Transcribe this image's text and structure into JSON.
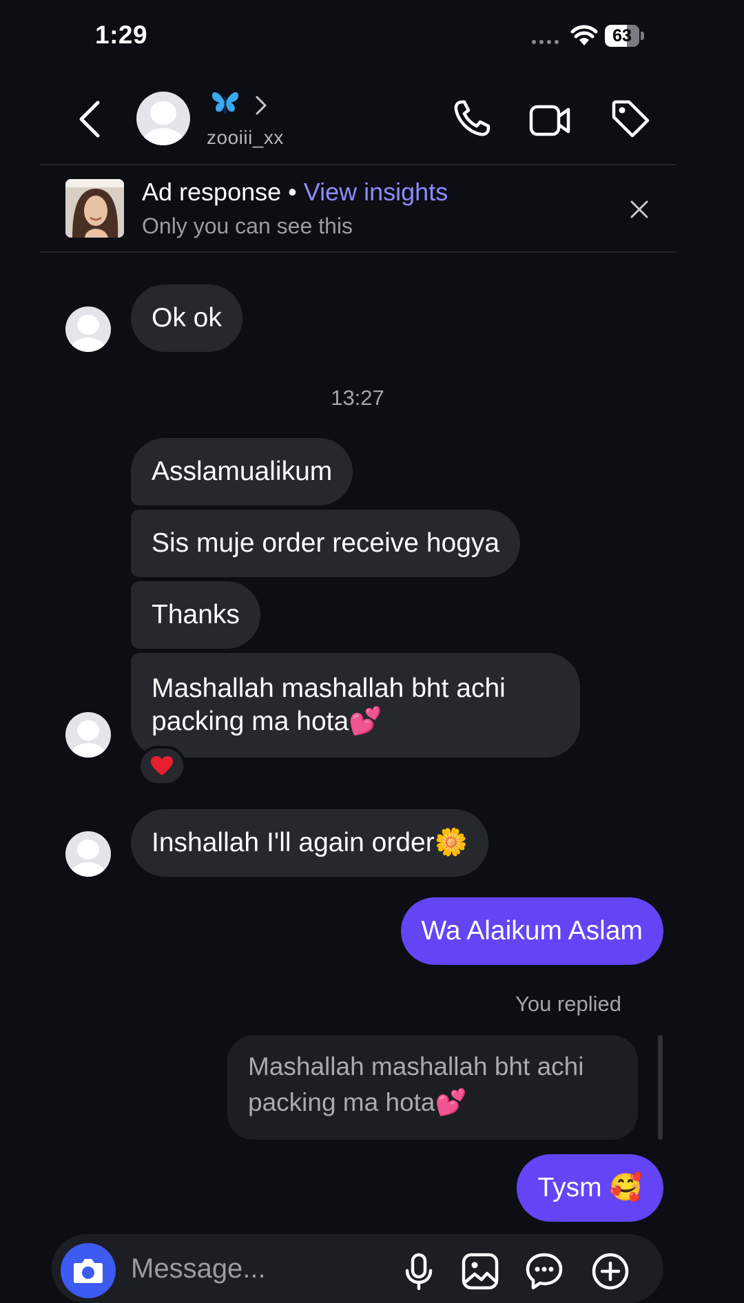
{
  "status_bar": {
    "time": "1:29",
    "battery": "63",
    "battery_level": 0.63
  },
  "header": {
    "name_emoji": "🦋",
    "username": "zooiii_xx"
  },
  "ad_banner": {
    "title": "Ad response",
    "separator": "•",
    "link": "View insights",
    "subtitle": "Only you can see this"
  },
  "messages": {
    "m1": "Ok ok",
    "timestamp": "13:27",
    "m2": "Asslamualikum",
    "m3": "Sis muje order receive hogya",
    "m4": "Thanks",
    "m5": "Mashallah mashallah bht achi packing ma hota💕",
    "m5_reaction": "❤️",
    "m6": "Inshallah I'll again order🌼",
    "m7": "Wa Alaikum Aslam",
    "you_replied": "You replied",
    "replied_quote": "Mashallah mashallah bht achi packing ma hota💕",
    "m8": "Tysm 🥰"
  },
  "composer": {
    "placeholder": "Message..."
  },
  "colors": {
    "background": "#0c0e14",
    "incoming_bubble": "#26282e",
    "outgoing_bubble": "#6445f5",
    "link": "#8c8cff",
    "camera_button": "#3d5af1"
  }
}
